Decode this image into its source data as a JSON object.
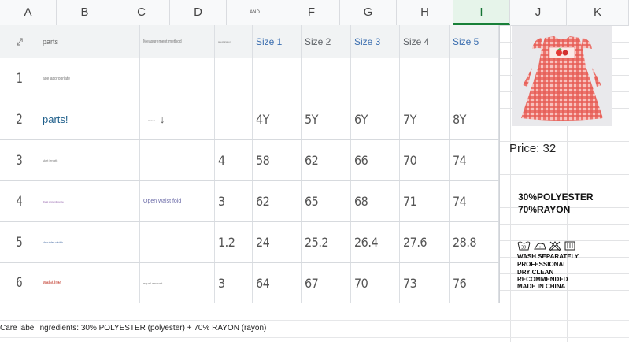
{
  "columns": [
    "A",
    "B",
    "C",
    "D",
    "AND",
    "F",
    "G",
    "H",
    "I",
    "J",
    "K"
  ],
  "selected_column": "I",
  "table": {
    "header": {
      "icon": "resize-arrows-icon",
      "parts": "parts",
      "measurement_method": "Measurement method",
      "tiny_d": "specification",
      "sizes": [
        "Size 1",
        "Size 2",
        "Size 3",
        "Size 4",
        "Size 5"
      ]
    },
    "rows": [
      {
        "num": "1",
        "part": "age appropriate",
        "method": "",
        "value": "",
        "sizes": [
          "",
          "",
          "",
          "",
          ""
        ]
      },
      {
        "num": "2",
        "part": "parts!",
        "method": "↓",
        "method_small": "– – –",
        "value": "",
        "sizes": [
          "4Y",
          "5Y",
          "6Y",
          "7Y",
          "8Y"
        ]
      },
      {
        "num": "3",
        "part": "skirt length",
        "method": "",
        "value": "4",
        "sizes": [
          "58",
          "62",
          "66",
          "70",
          "74"
        ]
      },
      {
        "num": "4",
        "part": "chest circumference",
        "method": "Open waist fold",
        "value": "3",
        "sizes": [
          "62",
          "65",
          "68",
          "71",
          "74"
        ]
      },
      {
        "num": "5",
        "part": "shoulder width",
        "method": "",
        "value": "1.2",
        "sizes": [
          "24",
          "25.2",
          "26.4",
          "27.6",
          "28.8"
        ]
      },
      {
        "num": "6",
        "part": "waistline",
        "method": "equal amount",
        "value": "3",
        "sizes": [
          "64",
          "67",
          "70",
          "73",
          "76"
        ]
      }
    ]
  },
  "product": {
    "price_label": "Price: 32",
    "composition_line1": "30%POLYESTER",
    "composition_line2": "70%RAYON",
    "care_icons": [
      "wash-30-icon",
      "iron-low-icon",
      "no-bleach-icon",
      "tumble-dry-icon"
    ],
    "care_lines": [
      "WASH SEPARATELY",
      "PROFESSIONAL",
      "DRY CLEAN",
      "RECOMMENDED",
      "MADE IN CHINA"
    ]
  },
  "footer": {
    "care_label_text": "Care label ingredients: 30% POLYESTER (polyester) + 70% RAYON (rayon)"
  },
  "colors": {
    "header_bg": "#f8f9fa",
    "selected_col_bg": "#e6f4ea",
    "selected_col_accent": "#188038",
    "size_blue": "#3c6fb0",
    "dress_red": "#e4564f"
  }
}
